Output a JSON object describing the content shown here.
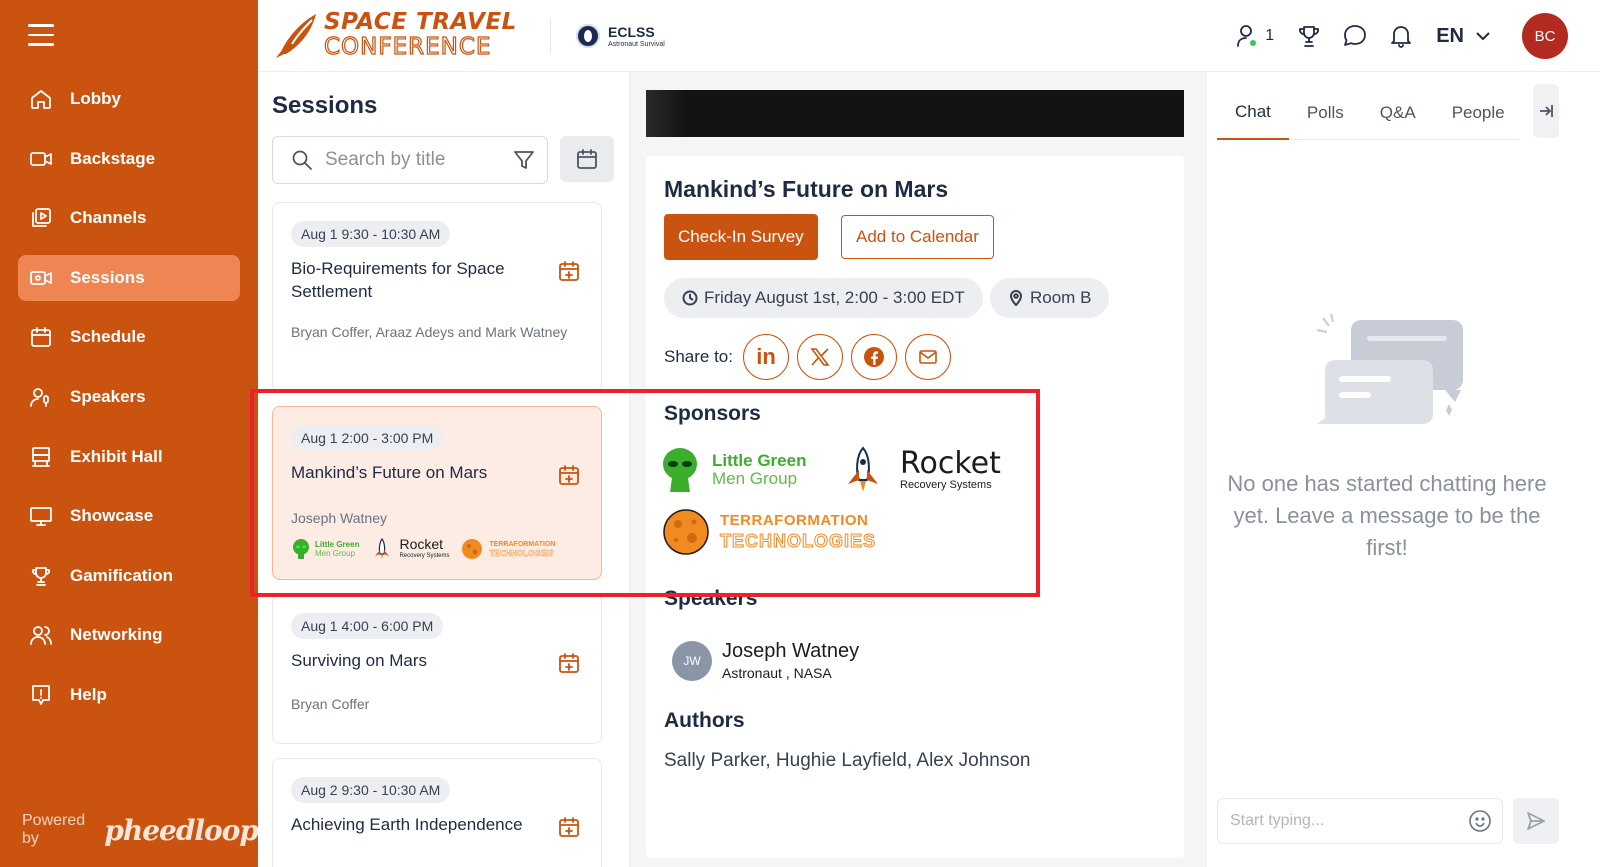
{
  "sidebar": {
    "items": [
      {
        "label": "Lobby",
        "icon": "home-icon"
      },
      {
        "label": "Backstage",
        "icon": "video-camera-icon"
      },
      {
        "label": "Channels",
        "icon": "channels-icon"
      },
      {
        "label": "Sessions",
        "icon": "sessions-icon",
        "active": true
      },
      {
        "label": "Schedule",
        "icon": "calendar-icon"
      },
      {
        "label": "Speakers",
        "icon": "speaker-icon"
      },
      {
        "label": "Exhibit Hall",
        "icon": "exhibit-icon"
      },
      {
        "label": "Showcase",
        "icon": "showcase-icon"
      },
      {
        "label": "Gamification",
        "icon": "trophy-icon"
      },
      {
        "label": "Networking",
        "icon": "people-icon"
      },
      {
        "label": "Help",
        "icon": "help-icon"
      }
    ],
    "powered_by": "Powered by",
    "powered_brand": "pheedloop"
  },
  "header": {
    "logo_line1": "SPACE TRAVEL",
    "logo_line2": "CONFERENCE",
    "partner_name": "ECLSS",
    "partner_sub": "Astronaut Survival",
    "online_count": "1",
    "language": "EN",
    "avatar_initials": "BC"
  },
  "sessions": {
    "title": "Sessions",
    "search_placeholder": "Search by title",
    "cards": [
      {
        "time": "Aug 1 9:30 - 10:30 AM",
        "title": "Bio-Requirements for Space Settlement",
        "people": "Bryan Coffer, Araaz Adeys and Mark Watney"
      },
      {
        "time": "Aug 1 2:00 - 3:00 PM",
        "title": "Mankind’s Future on Mars",
        "people": "Joseph Watney"
      },
      {
        "time": "Aug 1 4:00 - 6:00 PM",
        "title": "Surviving on Mars",
        "people": "Bryan Coffer"
      },
      {
        "time": "Aug 2 9:30 - 10:30 AM",
        "title": "Achieving Earth Independence",
        "people": ""
      }
    ]
  },
  "detail": {
    "title": "Mankind’s Future on Mars",
    "checkin_label": "Check-In Survey",
    "calendar_label": "Add to Calendar",
    "datetime": "Friday August 1st, 2:00 - 3:00 EDT",
    "room": "Room B",
    "share_label": "Share to:",
    "sponsors_heading": "Sponsors",
    "sponsors": [
      {
        "line1": "Little Green",
        "line2": "Men Group"
      },
      {
        "line1": "Rocket",
        "line2": "Recovery Systems"
      },
      {
        "line1": "TERRAFORMATION",
        "line2": "TECHNOLOGIES"
      }
    ],
    "speakers_heading": "Speakers",
    "speaker": {
      "initials": "JW",
      "name": "Joseph Watney",
      "role": "Astronaut ,  NASA"
    },
    "authors_heading": "Authors",
    "authors": "Sally Parker, Hughie Layfield, Alex Johnson"
  },
  "chat": {
    "tabs": [
      "Chat",
      "Polls",
      "Q&A",
      "People"
    ],
    "empty_message": "No one has started chatting here yet. Leave a message to be the first!",
    "input_placeholder": "Start typing..."
  },
  "colors": {
    "brand": "#c9530f",
    "highlight": "#e8232b"
  }
}
